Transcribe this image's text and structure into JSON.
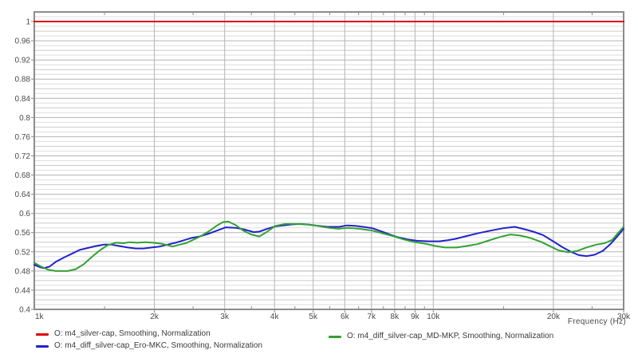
{
  "chart_data": {
    "type": "line",
    "title": "",
    "xlabel": "Frequency  (Hz)",
    "ylabel": "",
    "x_scale": "log",
    "x_range_hz": [
      1000,
      30000
    ],
    "y_range": [
      0.4,
      1.02
    ],
    "y_minor_step": 0.01,
    "grid": true,
    "legend_position": "bottom",
    "y_ticks": [
      {
        "v": 1.0,
        "label": "1"
      },
      {
        "v": 0.96,
        "label": "0.96"
      },
      {
        "v": 0.92,
        "label": "0.92"
      },
      {
        "v": 0.88,
        "label": "0.88"
      },
      {
        "v": 0.84,
        "label": "0.84"
      },
      {
        "v": 0.8,
        "label": "0.8"
      },
      {
        "v": 0.76,
        "label": "0.76"
      },
      {
        "v": 0.72,
        "label": "0.72"
      },
      {
        "v": 0.68,
        "label": "0.68"
      },
      {
        "v": 0.64,
        "label": "0.64"
      },
      {
        "v": 0.6,
        "label": "0.6"
      },
      {
        "v": 0.56,
        "label": "0.56"
      },
      {
        "v": 0.52,
        "label": "0.52"
      },
      {
        "v": 0.48,
        "label": "0.48"
      },
      {
        "v": 0.44,
        "label": "0.44"
      },
      {
        "v": 0.4,
        "label": "0.4"
      }
    ],
    "x_major_ticks": [
      {
        "hz": 1000,
        "label": "1k"
      },
      {
        "hz": 2000,
        "label": "2k"
      },
      {
        "hz": 3000,
        "label": "3k"
      },
      {
        "hz": 4000,
        "label": "4k"
      },
      {
        "hz": 5000,
        "label": "5k"
      },
      {
        "hz": 6000,
        "label": "6k"
      },
      {
        "hz": 7000,
        "label": "7k"
      },
      {
        "hz": 8000,
        "label": "8k"
      },
      {
        "hz": 9000,
        "label": "9k"
      },
      {
        "hz": 10000,
        "label": "10k"
      },
      {
        "hz": 20000,
        "label": "20k"
      },
      {
        "hz": 30000,
        "label": "30k"
      }
    ],
    "x_minor_ticks_hz": [
      1500,
      2500,
      3500,
      4500,
      5500,
      6500,
      7500,
      8500,
      9500,
      15000,
      25000
    ],
    "series": [
      {
        "name": "O: m4_silver-cap, Smoothing, Normalization",
        "color": "#dd0000",
        "points": [
          [
            1000,
            1.0
          ],
          [
            30000,
            1.0
          ]
        ]
      },
      {
        "name": "O: m4_diff_silver-cap_Ero-MKC, Smoothing, Normalization",
        "color": "#2222cc",
        "points": [
          [
            1000,
            0.493
          ],
          [
            1033,
            0.488
          ],
          [
            1057,
            0.486
          ],
          [
            1091,
            0.489
          ],
          [
            1132,
            0.499
          ],
          [
            1186,
            0.508
          ],
          [
            1242,
            0.516
          ],
          [
            1300,
            0.524
          ],
          [
            1361,
            0.528
          ],
          [
            1426,
            0.532
          ],
          [
            1493,
            0.535
          ],
          [
            1563,
            0.535
          ],
          [
            1637,
            0.532
          ],
          [
            1714,
            0.529
          ],
          [
            1795,
            0.527
          ],
          [
            1879,
            0.527
          ],
          [
            1968,
            0.529
          ],
          [
            2061,
            0.531
          ],
          [
            2158,
            0.535
          ],
          [
            2260,
            0.539
          ],
          [
            2366,
            0.544
          ],
          [
            2478,
            0.549
          ],
          [
            2594,
            0.552
          ],
          [
            2717,
            0.557
          ],
          [
            2845,
            0.563
          ],
          [
            3020,
            0.571
          ],
          [
            3192,
            0.57
          ],
          [
            3342,
            0.567
          ],
          [
            3548,
            0.561
          ],
          [
            3664,
            0.562
          ],
          [
            3837,
            0.568
          ],
          [
            4018,
            0.573
          ],
          [
            4208,
            0.575
          ],
          [
            4406,
            0.577
          ],
          [
            4614,
            0.578
          ],
          [
            4831,
            0.577
          ],
          [
            5059,
            0.575
          ],
          [
            5420,
            0.572
          ],
          [
            5808,
            0.572
          ],
          [
            6081,
            0.575
          ],
          [
            6368,
            0.574
          ],
          [
            6668,
            0.572
          ],
          [
            7047,
            0.569
          ],
          [
            7499,
            0.561
          ],
          [
            7852,
            0.555
          ],
          [
            8111,
            0.551
          ],
          [
            8610,
            0.546
          ],
          [
            9120,
            0.543
          ],
          [
            9772,
            0.542
          ],
          [
            10351,
            0.542
          ],
          [
            10839,
            0.544
          ],
          [
            11350,
            0.547
          ],
          [
            12134,
            0.553
          ],
          [
            13000,
            0.559
          ],
          [
            13900,
            0.564
          ],
          [
            14928,
            0.569
          ],
          [
            16000,
            0.572
          ],
          [
            16750,
            0.568
          ],
          [
            17800,
            0.562
          ],
          [
            18836,
            0.555
          ],
          [
            19884,
            0.543
          ],
          [
            21135,
            0.529
          ],
          [
            22131,
            0.52
          ],
          [
            23174,
            0.513
          ],
          [
            24266,
            0.511
          ],
          [
            25410,
            0.514
          ],
          [
            26607,
            0.522
          ],
          [
            27861,
            0.537
          ],
          [
            28840,
            0.551
          ],
          [
            30000,
            0.568
          ]
        ]
      },
      {
        "name": "O: m4_diff_silver-cap_MD-MKP, Smoothing, Normalization",
        "color": "#33a133",
        "points": [
          [
            1000,
            0.497
          ],
          [
            1042,
            0.489
          ],
          [
            1081,
            0.483
          ],
          [
            1132,
            0.48
          ],
          [
            1213,
            0.48
          ],
          [
            1271,
            0.484
          ],
          [
            1330,
            0.494
          ],
          [
            1393,
            0.509
          ],
          [
            1459,
            0.523
          ],
          [
            1528,
            0.534
          ],
          [
            1600,
            0.539
          ],
          [
            1675,
            0.538
          ],
          [
            1730,
            0.54
          ],
          [
            1811,
            0.539
          ],
          [
            1896,
            0.54
          ],
          [
            1986,
            0.539
          ],
          [
            2080,
            0.537
          ],
          [
            2158,
            0.534
          ],
          [
            2218,
            0.531
          ],
          [
            2312,
            0.535
          ],
          [
            2399,
            0.538
          ],
          [
            2500,
            0.545
          ],
          [
            2618,
            0.553
          ],
          [
            2742,
            0.563
          ],
          [
            2871,
            0.575
          ],
          [
            2972,
            0.582
          ],
          [
            3063,
            0.583
          ],
          [
            3192,
            0.576
          ],
          [
            3342,
            0.564
          ],
          [
            3499,
            0.556
          ],
          [
            3664,
            0.552
          ],
          [
            3837,
            0.562
          ],
          [
            4018,
            0.574
          ],
          [
            4260,
            0.578
          ],
          [
            4550,
            0.578
          ],
          [
            4831,
            0.577
          ],
          [
            5128,
            0.574
          ],
          [
            5470,
            0.57
          ],
          [
            5780,
            0.568
          ],
          [
            6110,
            0.57
          ],
          [
            6516,
            0.568
          ],
          [
            7047,
            0.564
          ],
          [
            7499,
            0.558
          ],
          [
            7925,
            0.553
          ],
          [
            8414,
            0.546
          ],
          [
            9000,
            0.54
          ],
          [
            9550,
            0.537
          ],
          [
            10150,
            0.532
          ],
          [
            10700,
            0.529
          ],
          [
            11450,
            0.529
          ],
          [
            12100,
            0.532
          ],
          [
            12900,
            0.536
          ],
          [
            13700,
            0.543
          ],
          [
            14700,
            0.551
          ],
          [
            15600,
            0.556
          ],
          [
            16500,
            0.554
          ],
          [
            17500,
            0.549
          ],
          [
            18600,
            0.541
          ],
          [
            19700,
            0.531
          ],
          [
            20600,
            0.523
          ],
          [
            21800,
            0.519
          ],
          [
            23000,
            0.522
          ],
          [
            24200,
            0.529
          ],
          [
            25600,
            0.535
          ],
          [
            26900,
            0.538
          ],
          [
            28100,
            0.545
          ],
          [
            28900,
            0.557
          ],
          [
            30000,
            0.572
          ]
        ]
      }
    ],
    "style": {
      "plot_border_color": "#8c8c8c",
      "grid_minor_color": "#dedede",
      "grid_mid_color": "#cbcbcb",
      "grid_major_color": "#b3b3b3",
      "tick_color": "#8a8a8a",
      "axis_text_color": "#4a4a4a"
    }
  }
}
